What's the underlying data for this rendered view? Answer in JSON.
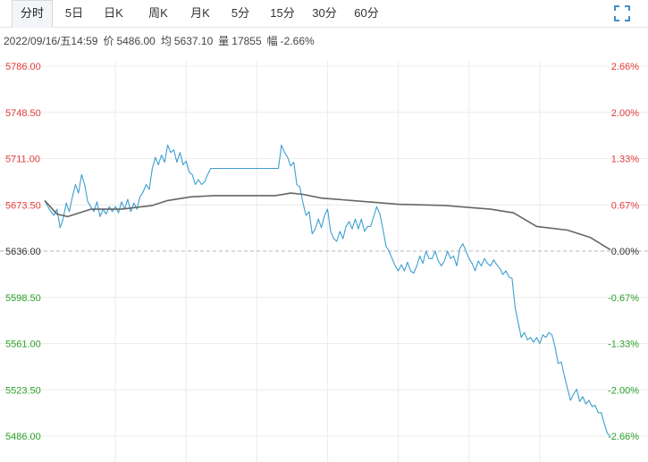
{
  "tabs": {
    "items": [
      "分时",
      "5日",
      "日K",
      "周K",
      "月K",
      "5分",
      "15分",
      "30分",
      "60分"
    ],
    "active": 0
  },
  "info": {
    "datetime": "2022/09/16/五14:59",
    "price_label": "价",
    "price": "5486.00",
    "avg_label": "均",
    "avg": "5637.10",
    "volume_label": "量",
    "volume": "17855",
    "change_label": "幅",
    "change": "-2.66%"
  },
  "colors": {
    "price_line": "#3d9fd0",
    "avg_line": "#666666",
    "up": "#e23b3b",
    "down": "#2aa02a",
    "flat": "#333333",
    "grid": "#ececec",
    "baseline": "#b5b5b5"
  },
  "icons": {
    "expand": "expand-corners-icon"
  },
  "chart_data": {
    "type": "line",
    "prev_close": 5636.0,
    "ylim": [
      5486.0,
      5786.0
    ],
    "y_ticks": [
      "5786.00",
      "5748.50",
      "5711.00",
      "5673.50",
      "5636.00",
      "5598.50",
      "5561.00",
      "5523.50",
      "5486.00"
    ],
    "pct_ticks": [
      "2.66%",
      "2.00%",
      "1.33%",
      "0.67%",
      "0.00%",
      "-0.67%",
      "-1.33%",
      "-2.00%",
      "-2.66%"
    ],
    "session_points": 240,
    "series": [
      {
        "role": "price",
        "points": [
          [
            0,
            5677
          ],
          [
            3,
            5670
          ],
          [
            6,
            5665
          ],
          [
            8,
            5670
          ],
          [
            10,
            5655
          ],
          [
            12,
            5662
          ],
          [
            14,
            5675
          ],
          [
            16,
            5668
          ],
          [
            18,
            5680
          ],
          [
            20,
            5690
          ],
          [
            22,
            5683
          ],
          [
            24,
            5698
          ],
          [
            26,
            5690
          ],
          [
            28,
            5676
          ],
          [
            30,
            5672
          ],
          [
            32,
            5668
          ],
          [
            34,
            5676
          ],
          [
            36,
            5664
          ],
          [
            38,
            5670
          ],
          [
            40,
            5666
          ],
          [
            42,
            5672
          ],
          [
            44,
            5668
          ],
          [
            46,
            5672
          ],
          [
            48,
            5667
          ],
          [
            50,
            5676
          ],
          [
            52,
            5670
          ],
          [
            54,
            5678
          ],
          [
            56,
            5668
          ],
          [
            58,
            5675
          ],
          [
            60,
            5670
          ],
          [
            62,
            5680
          ],
          [
            64,
            5684
          ],
          [
            66,
            5690
          ],
          [
            68,
            5686
          ],
          [
            70,
            5703
          ],
          [
            72,
            5712
          ],
          [
            74,
            5706
          ],
          [
            76,
            5714
          ],
          [
            78,
            5708
          ],
          [
            80,
            5722
          ],
          [
            82,
            5716
          ],
          [
            84,
            5718
          ],
          [
            86,
            5708
          ],
          [
            88,
            5716
          ],
          [
            90,
            5706
          ],
          [
            92,
            5709
          ],
          [
            94,
            5700
          ],
          [
            96,
            5698
          ],
          [
            98,
            5690
          ],
          [
            100,
            5694
          ],
          [
            102,
            5690
          ],
          [
            104,
            5692
          ],
          [
            106,
            5698
          ],
          [
            108,
            5703
          ],
          [
            110,
            5703
          ],
          [
            130,
            5703
          ],
          [
            150,
            5703
          ],
          [
            152,
            5703
          ],
          [
            154,
            5722
          ],
          [
            156,
            5716
          ],
          [
            158,
            5712
          ],
          [
            160,
            5705
          ],
          [
            162,
            5708
          ],
          [
            164,
            5690
          ],
          [
            166,
            5688
          ],
          [
            168,
            5675
          ],
          [
            170,
            5665
          ],
          [
            172,
            5668
          ],
          [
            174,
            5650
          ],
          [
            176,
            5654
          ],
          [
            178,
            5662
          ],
          [
            180,
            5655
          ],
          [
            182,
            5665
          ],
          [
            184,
            5670
          ],
          [
            186,
            5652
          ],
          [
            188,
            5646
          ],
          [
            190,
            5644
          ],
          [
            192,
            5652
          ],
          [
            194,
            5646
          ],
          [
            196,
            5656
          ],
          [
            198,
            5660
          ],
          [
            200,
            5654
          ],
          [
            202,
            5662
          ],
          [
            204,
            5654
          ],
          [
            206,
            5662
          ],
          [
            208,
            5652
          ],
          [
            210,
            5656
          ],
          [
            212,
            5656
          ],
          [
            214,
            5664
          ],
          [
            216,
            5672
          ],
          [
            218,
            5666
          ],
          [
            220,
            5654
          ],
          [
            222,
            5640
          ],
          [
            224,
            5636
          ],
          [
            226,
            5630
          ],
          [
            228,
            5624
          ],
          [
            230,
            5620
          ],
          [
            232,
            5625
          ],
          [
            234,
            5620
          ],
          [
            236,
            5627
          ],
          [
            238,
            5620
          ],
          [
            240,
            5618
          ],
          [
            242,
            5624
          ],
          [
            244,
            5632
          ],
          [
            246,
            5626
          ],
          [
            248,
            5636
          ],
          [
            250,
            5630
          ],
          [
            252,
            5630
          ],
          [
            254,
            5636
          ],
          [
            256,
            5628
          ],
          [
            258,
            5624
          ],
          [
            260,
            5628
          ],
          [
            262,
            5636
          ],
          [
            264,
            5630
          ],
          [
            266,
            5632
          ],
          [
            268,
            5624
          ],
          [
            270,
            5638
          ],
          [
            272,
            5642
          ],
          [
            274,
            5636
          ],
          [
            276,
            5630
          ],
          [
            278,
            5626
          ],
          [
            280,
            5620
          ],
          [
            282,
            5628
          ],
          [
            284,
            5624
          ],
          [
            286,
            5630
          ],
          [
            288,
            5626
          ],
          [
            290,
            5624
          ],
          [
            292,
            5629
          ],
          [
            294,
            5625
          ],
          [
            296,
            5622
          ],
          [
            298,
            5617
          ],
          [
            300,
            5620
          ],
          [
            302,
            5615
          ],
          [
            304,
            5614
          ],
          [
            306,
            5590
          ],
          [
            308,
            5578
          ],
          [
            310,
            5566
          ],
          [
            312,
            5570
          ],
          [
            314,
            5564
          ],
          [
            316,
            5566
          ],
          [
            318,
            5562
          ],
          [
            320,
            5566
          ],
          [
            322,
            5561
          ],
          [
            324,
            5568
          ],
          [
            326,
            5566
          ],
          [
            328,
            5570
          ],
          [
            330,
            5568
          ],
          [
            332,
            5558
          ],
          [
            334,
            5545
          ],
          [
            336,
            5546
          ],
          [
            338,
            5535
          ],
          [
            340,
            5525
          ],
          [
            342,
            5515
          ],
          [
            344,
            5520
          ],
          [
            346,
            5524
          ],
          [
            348,
            5514
          ],
          [
            350,
            5518
          ],
          [
            352,
            5512
          ],
          [
            354,
            5515
          ],
          [
            356,
            5510
          ],
          [
            358,
            5511
          ],
          [
            360,
            5505
          ],
          [
            362,
            5505
          ],
          [
            364,
            5496
          ],
          [
            366,
            5488
          ],
          [
            368,
            5486
          ]
        ],
        "total_points": 368
      },
      {
        "role": "avg",
        "points": [
          [
            0,
            5677
          ],
          [
            8,
            5666
          ],
          [
            15,
            5664
          ],
          [
            30,
            5670
          ],
          [
            50,
            5670
          ],
          [
            70,
            5673
          ],
          [
            80,
            5677
          ],
          [
            95,
            5680
          ],
          [
            110,
            5681
          ],
          [
            150,
            5681
          ],
          [
            160,
            5683
          ],
          [
            168,
            5682
          ],
          [
            180,
            5679
          ],
          [
            200,
            5677
          ],
          [
            230,
            5674
          ],
          [
            260,
            5673
          ],
          [
            290,
            5670
          ],
          [
            305,
            5667
          ],
          [
            320,
            5656
          ],
          [
            340,
            5653
          ],
          [
            355,
            5647
          ],
          [
            368,
            5637
          ]
        ],
        "total_points": 368
      }
    ]
  }
}
